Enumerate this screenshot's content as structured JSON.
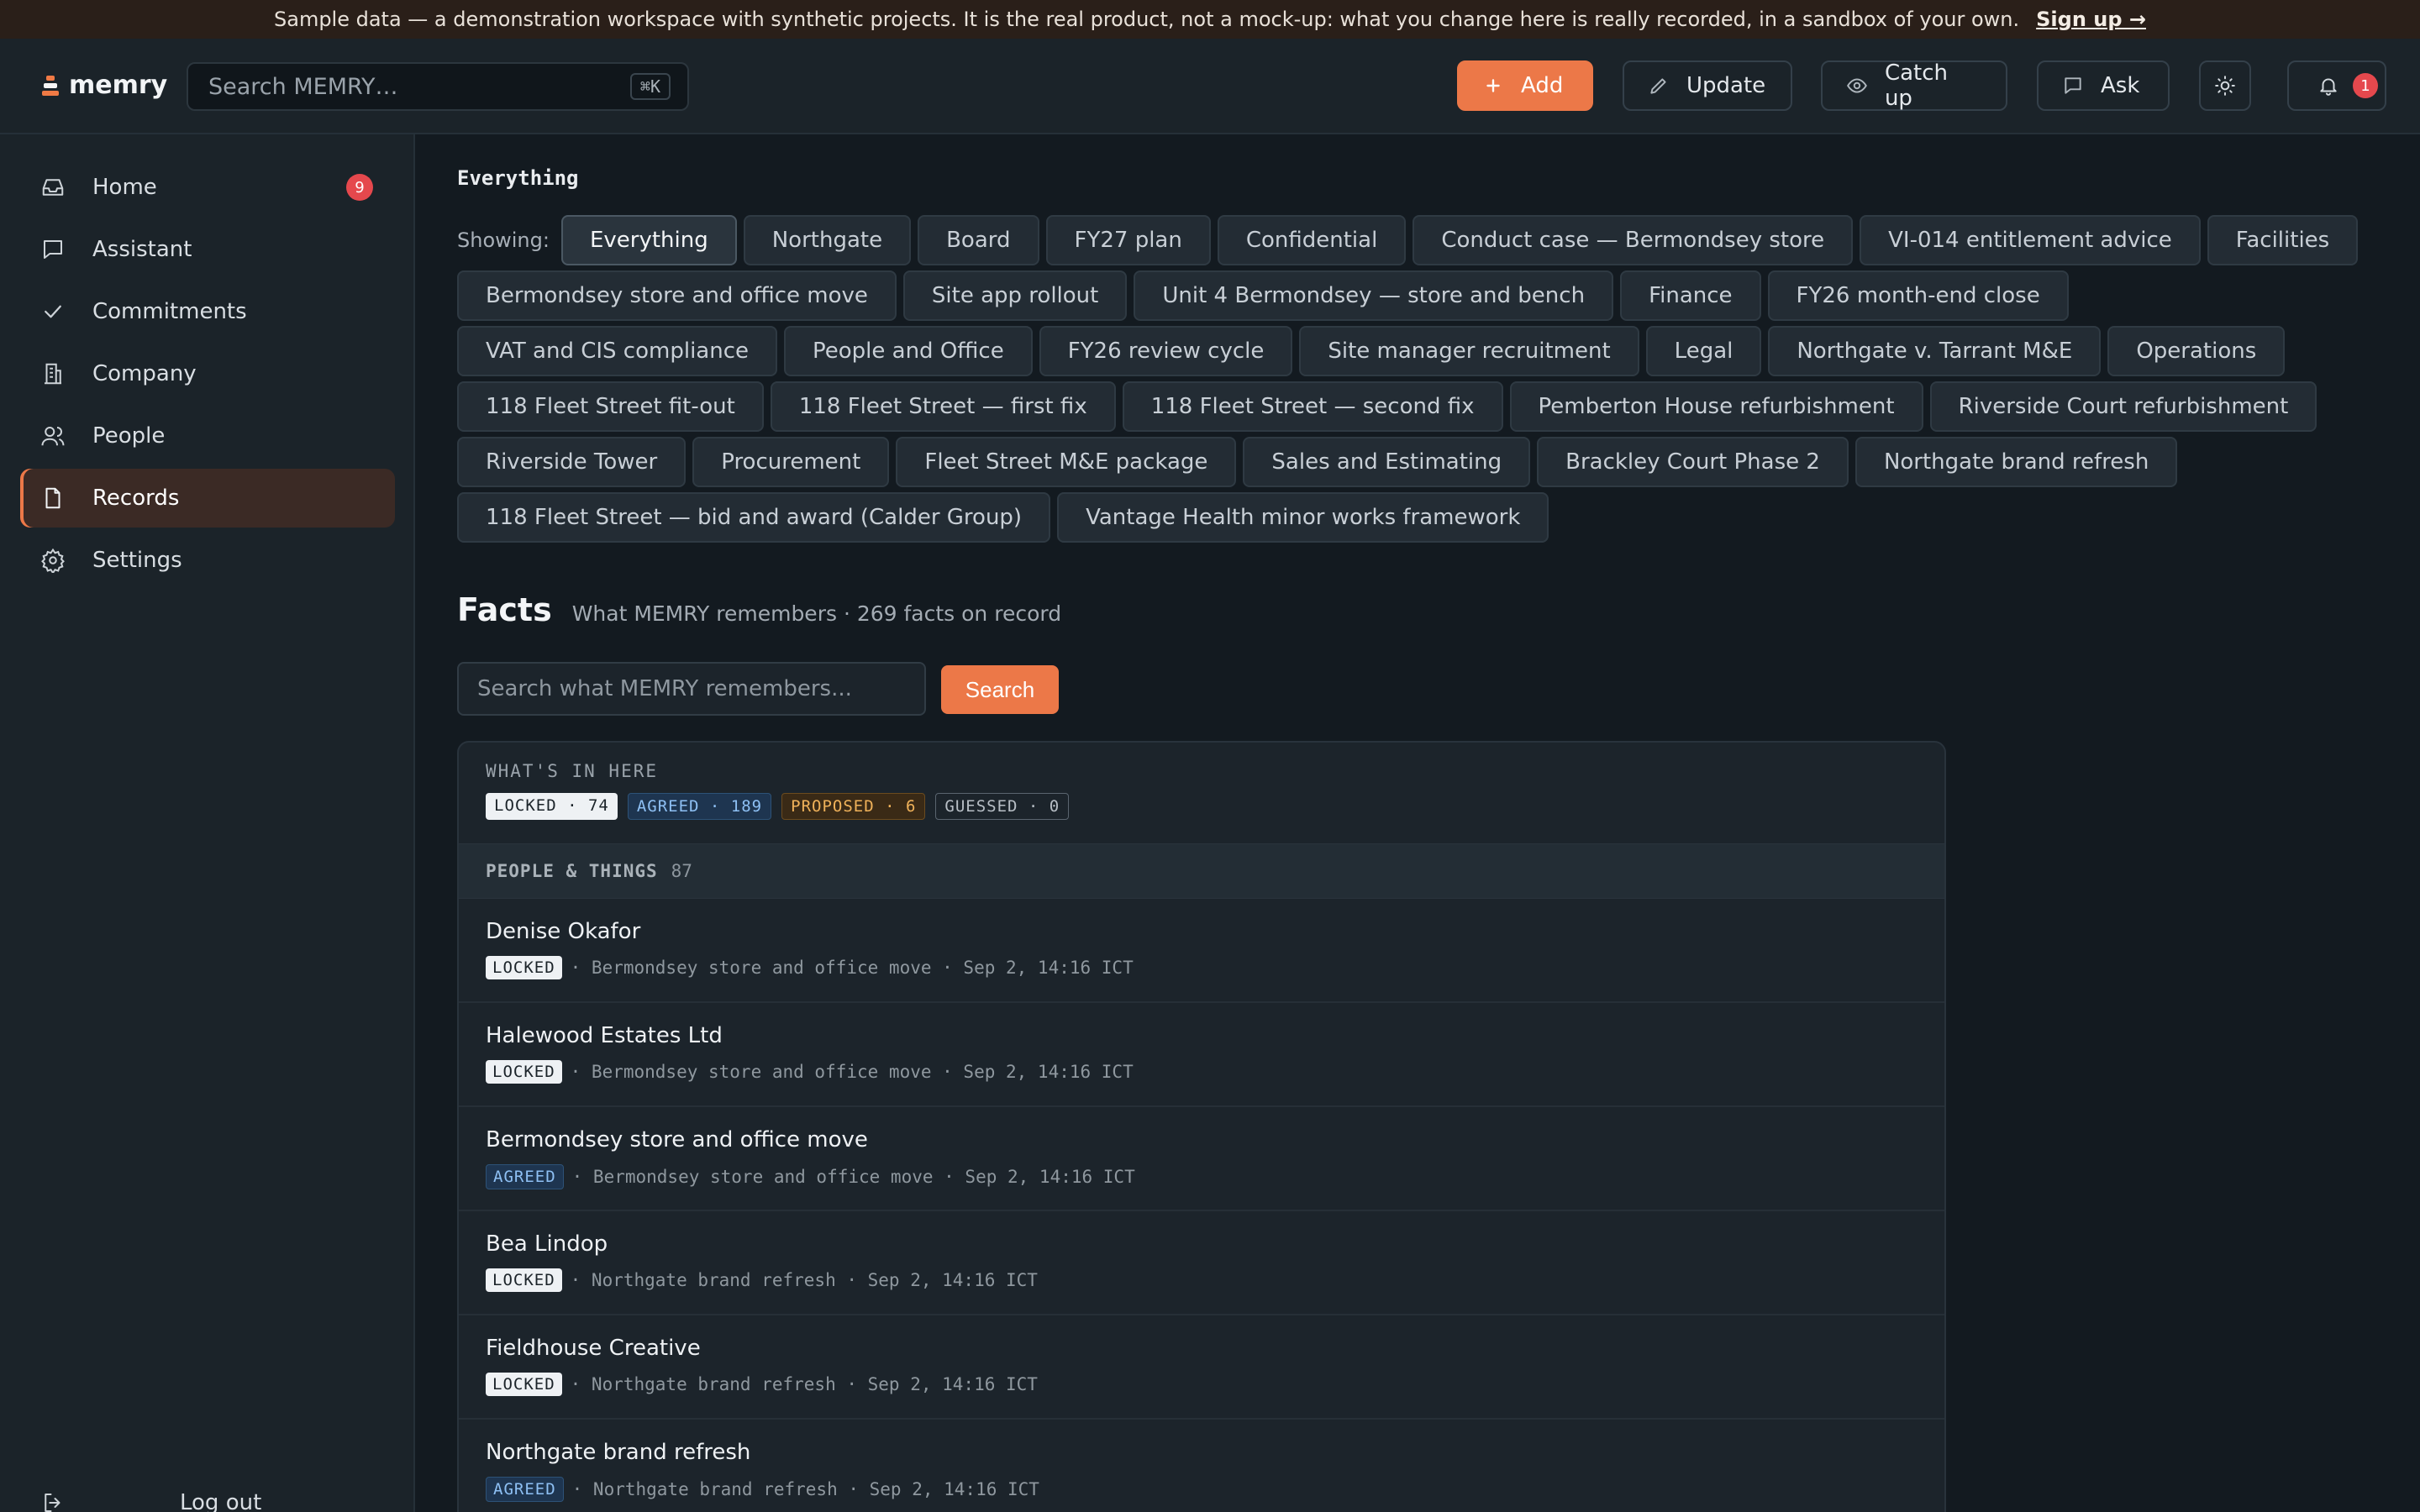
{
  "banner": {
    "text": "Sample data — a demonstration workspace with synthetic projects. It is the real product, not a mock-up: what you change here is really recorded, in a sandbox of your own.",
    "signup": "Sign up →"
  },
  "topbar": {
    "brand": "memry",
    "search_placeholder": "Search MEMRY…",
    "search_shortcut": "⌘K",
    "add_label": "Add",
    "update_label": "Update",
    "catchup_label": "Catch up",
    "ask_label": "Ask",
    "notification_count": "1"
  },
  "sidebar": {
    "items": [
      {
        "label": "Home",
        "icon": "inbox-icon",
        "count": "9"
      },
      {
        "label": "Assistant",
        "icon": "chat-icon"
      },
      {
        "label": "Commitments",
        "icon": "check-icon"
      },
      {
        "label": "Company",
        "icon": "building-icon"
      },
      {
        "label": "People",
        "icon": "people-icon"
      },
      {
        "label": "Records",
        "icon": "document-icon",
        "active": true
      },
      {
        "label": "Settings",
        "icon": "gear-icon"
      }
    ],
    "logout": "Log out"
  },
  "main": {
    "section_title": "Everything",
    "showing_label": "Showing:",
    "filters": [
      "Everything",
      "Northgate",
      "Board",
      "FY27 plan",
      "Confidential",
      "Conduct case — Bermondsey store",
      "VI-014 entitlement advice",
      "Facilities",
      "Bermondsey store and office move",
      "Site app rollout",
      "Unit 4 Bermondsey — store and bench",
      "Finance",
      "FY26 month-end close",
      "VAT and CIS compliance",
      "People and Office",
      "FY26 review cycle",
      "Site manager recruitment",
      "Legal",
      "Northgate v. Tarrant M&E",
      "Operations",
      "118 Fleet Street fit-out",
      "118 Fleet Street — first fix",
      "118 Fleet Street — second fix",
      "Pemberton House refurbishment",
      "Riverside Court refurbishment",
      "Riverside Tower",
      "Procurement",
      "Fleet Street M&E package",
      "Sales and Estimating",
      "Brackley Court Phase 2",
      "Northgate brand refresh",
      "118 Fleet Street — bid and award (Calder Group)",
      "Vantage Health minor works framework"
    ],
    "active_filter": "Everything",
    "facts": {
      "title": "Facts",
      "subtitle": "What MEMRY remembers · 269 facts on record",
      "search_placeholder": "Search what MEMRY remembers...",
      "search_button": "Search",
      "summary_title": "WHAT'S IN HERE",
      "pills": {
        "locked": "LOCKED · 74",
        "agreed": "AGREED · 189",
        "proposed": "PROPOSED · 6",
        "guessed": "GUESSED · 0"
      },
      "group": {
        "title": "PEOPLE & THINGS",
        "count": "87"
      },
      "rows": [
        {
          "name": "Denise Okafor",
          "status": "LOCKED",
          "meta": "· Bermondsey store and office move · Sep 2, 14:16 ICT"
        },
        {
          "name": "Halewood Estates Ltd",
          "status": "LOCKED",
          "meta": "· Bermondsey store and office move · Sep 2, 14:16 ICT"
        },
        {
          "name": "Bermondsey store and office move",
          "status": "AGREED",
          "meta": "· Bermondsey store and office move · Sep 2, 14:16 ICT"
        },
        {
          "name": "Bea Lindop",
          "status": "LOCKED",
          "meta": "· Northgate brand refresh · Sep 2, 14:16 ICT"
        },
        {
          "name": "Fieldhouse Creative",
          "status": "LOCKED",
          "meta": "· Northgate brand refresh · Sep 2, 14:16 ICT"
        },
        {
          "name": "Northgate brand refresh",
          "status": "AGREED",
          "meta": "· Northgate brand refresh · Sep 2, 14:16 ICT"
        }
      ]
    }
  },
  "colors": {
    "accent": "#ec7848",
    "background": "#131a20",
    "sidebar": "#1b2329",
    "badge": "#e5484d"
  }
}
